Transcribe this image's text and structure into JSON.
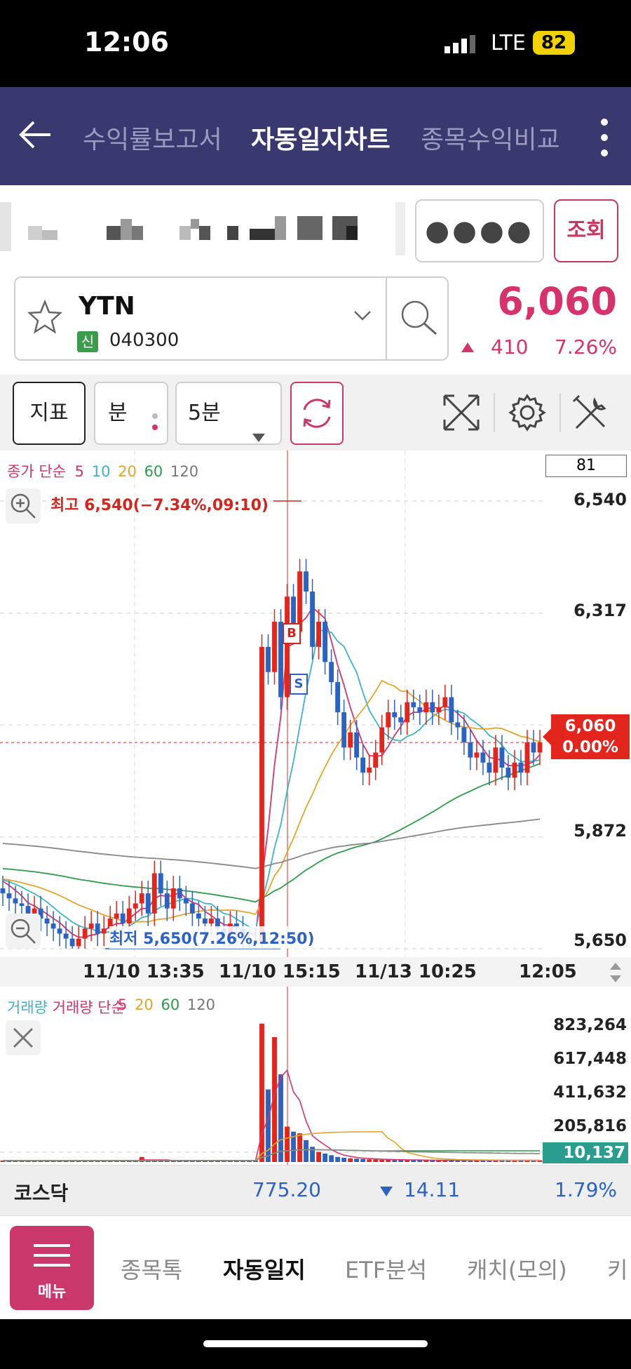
{
  "status": {
    "time": "12:06",
    "network": "LTE",
    "battery": "82"
  },
  "header": {
    "tabs": [
      {
        "label": "수익률보고서",
        "active": false
      },
      {
        "label": "자동일지차트",
        "active": true
      },
      {
        "label": "종목수익비교",
        "active": false
      }
    ]
  },
  "account": {
    "password_mask": "●●●●",
    "query_label": "조회"
  },
  "stock": {
    "name": "YTN",
    "badge": "신",
    "code": "040300",
    "price": "6,060",
    "change": "410",
    "change_pct": "7.26%"
  },
  "toolbar": {
    "indicator_label": "지표",
    "unit_label": "분",
    "interval_value": "5분"
  },
  "chart_data": {
    "type": "line",
    "legend": "종가 단순",
    "ma_periods": [
      "5",
      "10",
      "20",
      "60",
      "120"
    ],
    "ma_colors": [
      "#d6336c",
      "#3cb3c9",
      "#e3a52b",
      "#2e9b4a",
      "#888888"
    ],
    "counter": "81",
    "y_ticks": [
      "6,540",
      "6,317",
      "5,872",
      "5,650"
    ],
    "ylim": [
      5650,
      6540
    ],
    "x_ticks": [
      "11/10 13:35",
      "11/10 15:15",
      "11/13 10:25",
      "12:05"
    ],
    "high_label": "최고 6,540(−7.34%,09:10)",
    "low_label": "최저 5,650(7.26%,12:50)",
    "current_price": "6,060",
    "current_pct": "0.00%",
    "buy_marker": "B",
    "sell_marker": "S"
  },
  "volume_data": {
    "legend": "거래량 단순",
    "ma_periods": [
      "5",
      "20",
      "60",
      "120"
    ],
    "ma_colors": [
      "#d6336c",
      "#e3a52b",
      "#2e9b4a",
      "#888888"
    ],
    "y_ticks": [
      "823,264",
      "617,448",
      "411,632",
      "205,816"
    ],
    "current": "10,137"
  },
  "index": {
    "name": "코스닥",
    "value": "775.20",
    "change": "14.11",
    "pct": "1.79%"
  },
  "bottom_nav": {
    "menu_label": "메뉴",
    "items": [
      {
        "label": "종목톡",
        "active": false
      },
      {
        "label": "자동일지",
        "active": true
      },
      {
        "label": "ETF분석",
        "active": false
      },
      {
        "label": "캐치(모의)",
        "active": false
      },
      {
        "label": "키",
        "active": false
      }
    ]
  },
  "colors": {
    "header_bg": "#39386f",
    "accent": "#c9376b",
    "up": "#d6336c",
    "down": "#2b62c4"
  }
}
